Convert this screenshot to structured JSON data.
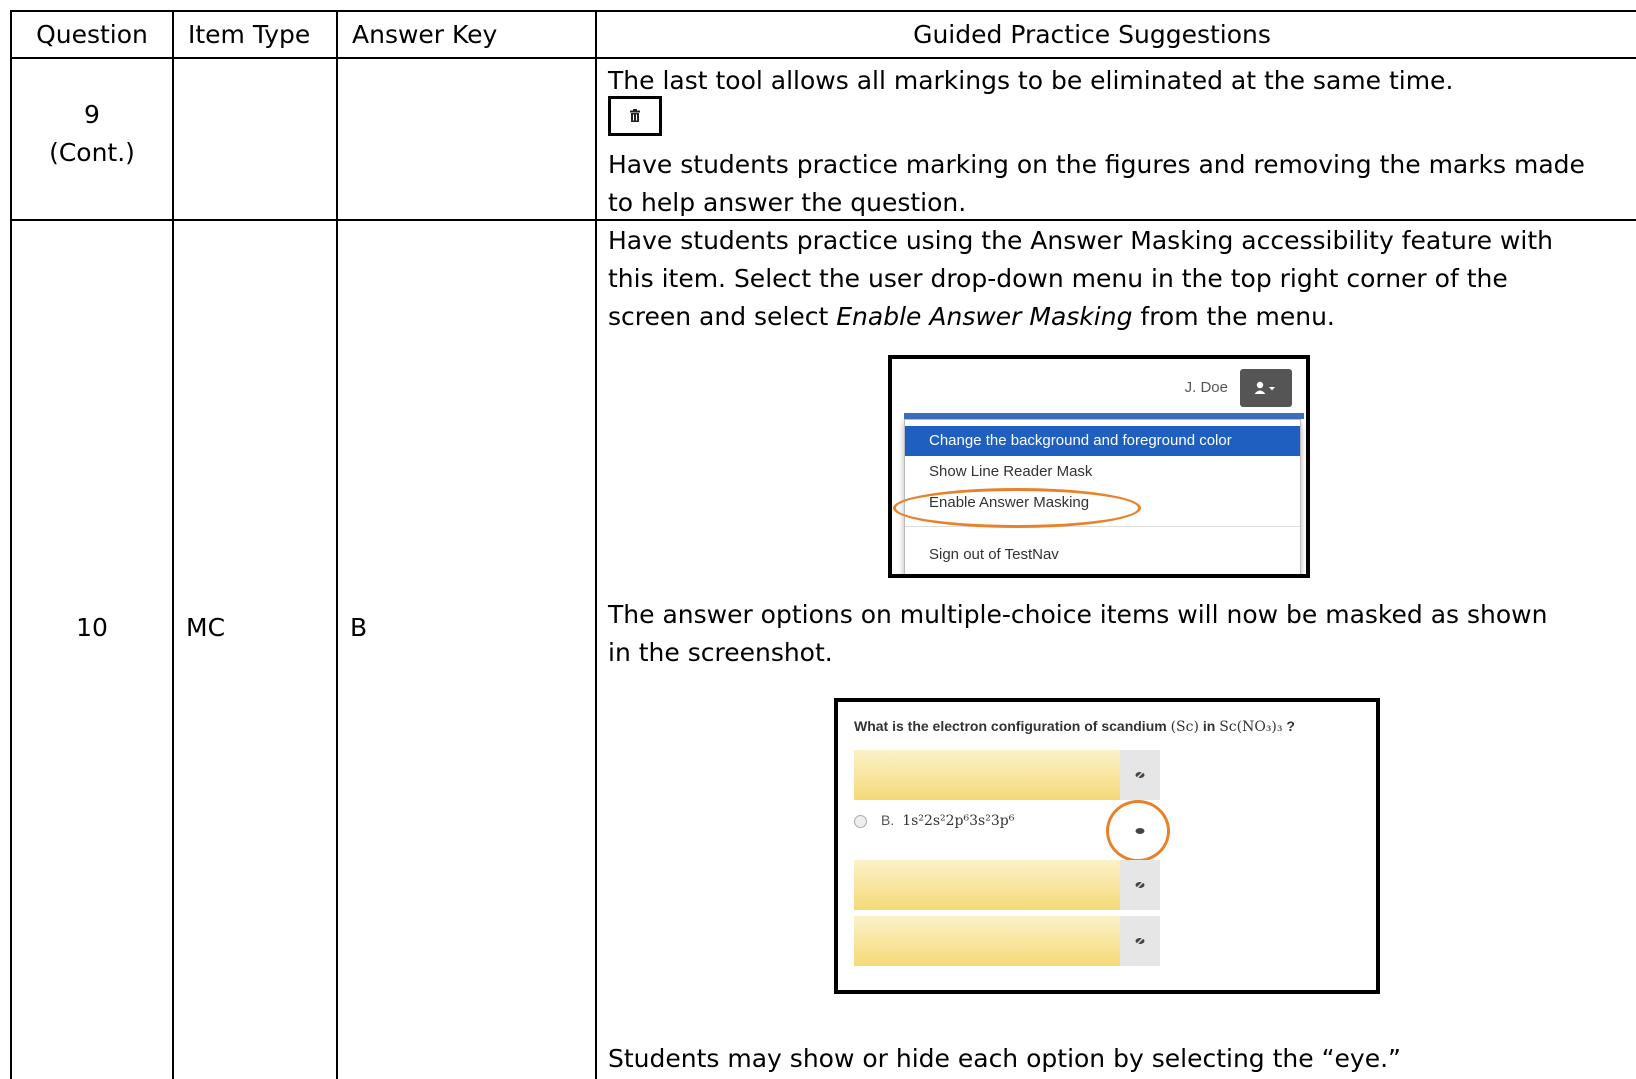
{
  "table": {
    "headers": [
      "Question",
      "Item Type",
      "Answer Key",
      "Guided Practice Suggestions"
    ],
    "row9": {
      "question_num": "9",
      "question_cont": "(Cont.)",
      "text1": "The last tool allows all markings to be eliminated at the same time.",
      "text2": "Have students practice marking on the figures and removing the marks made",
      "text3": "to help answer the question."
    },
    "row10": {
      "question": "10",
      "item_type": "MC",
      "answer_key": "B",
      "p1_line1": "Have students practice using the Answer Masking accessibility feature with",
      "p1_line2": "this item.  Select the user drop-down menu in the top right corner of the",
      "p1_line3_pre": "screen and select ",
      "p1_line3_em": "Enable Answer Masking",
      "p1_line3_post": " from the menu.",
      "p2_line1": "The answer options on multiple-choice items will now be masked as shown",
      "p2_line2": "in the screenshot.",
      "p3": "Students may show or hide each option by selecting the “eye.”"
    }
  },
  "menu_screenshot": {
    "user_name": "J. Doe",
    "items": [
      "Change the background and foreground color",
      "Show Line Reader Mask",
      "Enable Answer Masking",
      "Sign out of TestNav"
    ]
  },
  "mask_screenshot": {
    "question_pre": "What is the electron configuration of scandium ",
    "question_sym": "(Sc)",
    "question_mid": " in ",
    "question_formula": "Sc(NO₃)₃",
    "question_end": " ?",
    "option_b_label": "B.",
    "option_b_value": "1s²2s²2p⁶3s²3p⁶"
  },
  "colors": {
    "accent_orange": "#e8822a",
    "menu_blue": "#1f5fbf",
    "mask_yellow": "#f5d978"
  }
}
